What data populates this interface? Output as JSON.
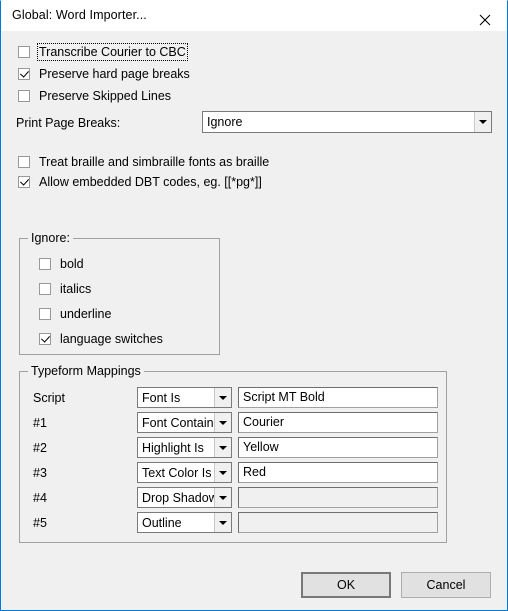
{
  "window": {
    "title": "Global: Word Importer...",
    "close_icon": "close-icon",
    "accent_color": "#0078d7",
    "background_color": "#f0f0f0"
  },
  "top_options": [
    {
      "label": "Transcribe Courier to CBC",
      "checked": false,
      "focused": true
    },
    {
      "label": "Preserve hard page breaks",
      "checked": true,
      "focused": false
    },
    {
      "label": "Preserve Skipped Lines",
      "checked": false,
      "focused": false
    }
  ],
  "print_page_breaks": {
    "label": "Print Page Breaks:",
    "value": "Ignore"
  },
  "braille_options": [
    {
      "label": "Treat braille and simbraille fonts as braille",
      "checked": false
    },
    {
      "label": "Allow embedded DBT codes, eg. [[*pg*]]",
      "checked": true
    }
  ],
  "ignore_group": {
    "title": "Ignore:",
    "items": [
      {
        "label": "bold",
        "checked": false
      },
      {
        "label": "italics",
        "checked": false
      },
      {
        "label": "underline",
        "checked": false
      },
      {
        "label": "language switches",
        "checked": true
      }
    ]
  },
  "typeform_group": {
    "title": "Typeform Mappings",
    "rows": [
      {
        "name": "Script",
        "condition": "Font Is",
        "value": "Script MT Bold",
        "disabled": false
      },
      {
        "name": "#1",
        "condition": "Font Contains",
        "value": "Courier",
        "disabled": false
      },
      {
        "name": "#2",
        "condition": "Highlight Is",
        "value": "Yellow",
        "disabled": false
      },
      {
        "name": "#3",
        "condition": "Text Color Is",
        "value": "Red",
        "disabled": false
      },
      {
        "name": "#4",
        "condition": "Drop Shadow",
        "value": "",
        "disabled": true
      },
      {
        "name": "#5",
        "condition": "Outline",
        "value": "",
        "disabled": true
      }
    ]
  },
  "buttons": {
    "ok": "OK",
    "cancel": "Cancel"
  }
}
